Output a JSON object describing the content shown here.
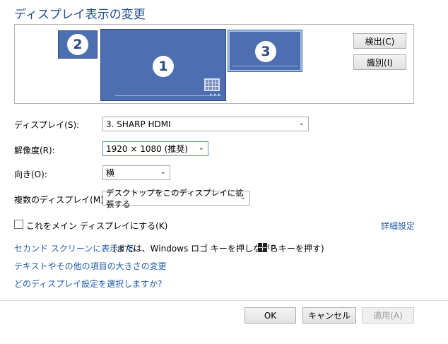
{
  "page": {
    "title": "ディスプレイ表示の変更"
  },
  "arrangement": {
    "monitors": [
      {
        "number": "2"
      },
      {
        "number": "1"
      },
      {
        "number": "3"
      }
    ],
    "detect_label": "検出(C)",
    "identify_label": "識別(I)"
  },
  "settings": {
    "display": {
      "label": "ディスプレイ(S):",
      "value": "3. SHARP HDMI"
    },
    "resolution": {
      "label": "解像度(R):",
      "value": "1920 × 1080 (推奨)"
    },
    "orientation": {
      "label": "向き(O):",
      "value": "横"
    },
    "multiple": {
      "label": "複数のディスプレイ(M):",
      "value": "デスクトップをこのディスプレイに拡張する"
    }
  },
  "main_display": {
    "checkbox_label": "これをメイン ディスプレイにする(K)",
    "checked": false
  },
  "advanced_link": "詳細設定",
  "links": {
    "second_screen": "セカンド スクリーンに表示する",
    "second_screen_hint_prefix": "(または、Windows ロゴ キーを押しながら",
    "second_screen_hint_suffix": "P キーを押す)",
    "text_size": "テキストやその他の項目の大きさの変更",
    "which_setting": "どのディスプレイ設定を選択しますか?"
  },
  "footer": {
    "ok": "OK",
    "cancel": "キャンセル",
    "apply": "適用(A)"
  },
  "icons": {
    "windows": "windows-logo-icon",
    "dropdown": "chevron-down-icon"
  },
  "colors": {
    "title": "#1e4e8c",
    "link": "#1f5ea8",
    "monitor": "#4d6fb1"
  }
}
